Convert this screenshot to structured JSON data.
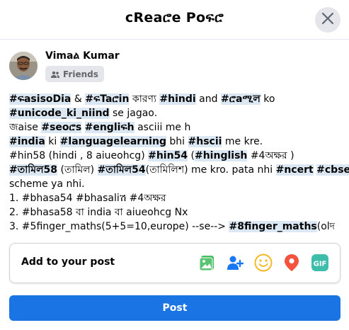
{
  "dialog": {
    "title": "cReaሮe Poፍሮ"
  },
  "author": {
    "name": "Vimaል Kumar",
    "audience": "Friends"
  },
  "post": {
    "lines": [
      [
        {
          "t": "#ፍasisoDia",
          "h": true
        },
        {
          "t": " & ",
          "h": false
        },
        {
          "t": "#ፍTaሮin",
          "h": true
        },
        {
          "t": " কারণ্য ",
          "h": false
        },
        {
          "t": "#hindi",
          "h": true
        },
        {
          "t": " and ",
          "h": false
        },
        {
          "t": "#ሮaሚল",
          "h": true
        },
        {
          "t": " ko",
          "h": false
        }
      ],
      [
        {
          "t": "#unicode_ki_niind",
          "h": true
        },
        {
          "t": " se jagao.",
          "h": false
        }
      ],
      [
        {
          "t": "জaise ",
          "h": false
        },
        {
          "t": "#seoሮs",
          "h": true
        },
        {
          "t": " ",
          "h": false
        },
        {
          "t": "#engliፍh",
          "h": true
        },
        {
          "t": " asciii me h",
          "h": false
        }
      ],
      [
        {
          "t": "#india",
          "h": true
        },
        {
          "t": " ki ",
          "h": false
        },
        {
          "t": "#languagelearning",
          "h": true
        },
        {
          "t": " bhi ",
          "h": false
        },
        {
          "t": "#hscii",
          "h": true
        },
        {
          "t": " me kre.",
          "h": false
        }
      ],
      [
        {
          "t": "#hin58 (hindi , 8 aiueohcg) ",
          "h": false
        },
        {
          "t": "#hin54",
          "h": true
        },
        {
          "t": " (",
          "h": false
        },
        {
          "t": "#hinglish",
          "h": true
        },
        {
          "t": " #4অক্ষর )",
          "h": false
        }
      ],
      [
        {
          "t": "#তামিল58",
          "h": true
        },
        {
          "t": " (তামিল) ",
          "h": false
        },
        {
          "t": "#তামিল54",
          "h": true
        },
        {
          "t": "(তামিলিশ) me kro. pata nhi ",
          "h": false
        },
        {
          "t": "#ncert",
          "h": true
        },
        {
          "t": " ",
          "h": false
        },
        {
          "t": "#cbse",
          "h": true
        }
      ],
      [
        {
          "t": "scheme ya nhi.",
          "h": false
        }
      ],
      [
        {
          "t": "1. #bhasa54 #bhasaliሽ #4অক্ষর",
          "h": false
        }
      ],
      [
        {
          "t": "2. #bhasa58 বা india বা aiueohcg Nx",
          "h": false
        }
      ],
      [
        {
          "t": "3. #5finger_maths(5+5=10,europe) --se--> ",
          "h": false
        },
        {
          "t": "#8finger_maths",
          "h": true
        },
        {
          "t": "(olদ",
          "h": false
        }
      ]
    ]
  },
  "composer": {
    "add_label": "Add to your post",
    "icons": [
      "photo-video-icon",
      "tag-people-icon",
      "feeling-icon",
      "location-icon",
      "gif-icon"
    ],
    "colors": {
      "photo": "#45bd62",
      "tag": "#1877f2",
      "feeling": "#f7b928",
      "location": "#f5533d",
      "gif": "#3fbdab"
    }
  },
  "actions": {
    "post_label": "Post",
    "post_color": "#1b74e4"
  }
}
